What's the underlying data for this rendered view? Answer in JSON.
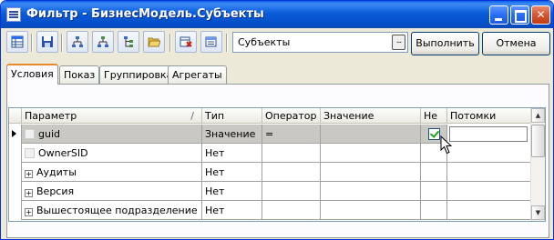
{
  "window": {
    "title": "Фильтр - БизнесМодель.Субъекты",
    "colors": {
      "titlebar": "#0a5bd8",
      "close": "#c23b14",
      "selected_row": "#c9c8c3"
    }
  },
  "toolbar": {
    "icons": [
      "grid-icon",
      "save-icon",
      "tree-icon",
      "tree-alt-icon",
      "hierarchy-icon",
      "folder-open-icon",
      "delete-icon",
      "properties-icon"
    ],
    "object_combo_value": "Субъекты",
    "combo_button_label": "...",
    "execute_label": "Выполнить",
    "cancel_label": "Отмена"
  },
  "tabs": [
    {
      "label": "Условия",
      "active": true
    },
    {
      "label": "Показ",
      "active": false
    },
    {
      "label": "Группировка",
      "active": false
    },
    {
      "label": "Агрегаты",
      "active": false
    }
  ],
  "grid": {
    "columns": [
      "Параметр",
      "Тип",
      "Оператор",
      "Значение",
      "Не",
      "Потомки"
    ],
    "sort_indicator": "/",
    "rows": [
      {
        "param": "guid",
        "type": "Значение",
        "operator": "=",
        "value": "",
        "not": true,
        "descendants": "",
        "expandable": false,
        "selected": true
      },
      {
        "param": "OwnerSID",
        "type": "Нет",
        "operator": "",
        "value": "",
        "not": false,
        "descendants": "",
        "expandable": false,
        "selected": false
      },
      {
        "param": "Аудиты",
        "type": "Нет",
        "operator": "",
        "value": "",
        "not": false,
        "descendants": "",
        "expandable": true,
        "selected": false
      },
      {
        "param": "Версия",
        "type": "Нет",
        "operator": "",
        "value": "",
        "not": false,
        "descendants": "",
        "expandable": true,
        "selected": false
      },
      {
        "param": "Вышестоящее подразделение",
        "type": "Нет",
        "operator": "",
        "value": "",
        "not": false,
        "descendants": "",
        "expandable": true,
        "selected": false
      }
    ],
    "expander_glyph": "+"
  }
}
